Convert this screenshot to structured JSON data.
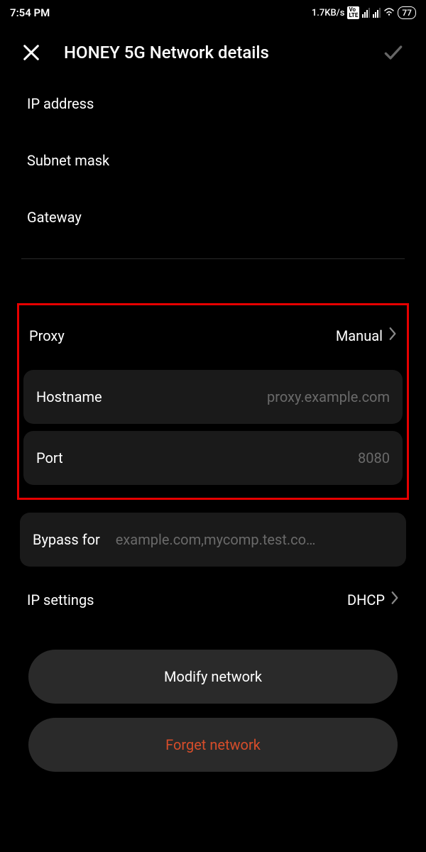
{
  "status_bar": {
    "time": "7:54 PM",
    "speed": "1.7KB/s",
    "volte": "Vo LTE",
    "battery": "77"
  },
  "header": {
    "title": "HONEY 5G Network details"
  },
  "fields": {
    "ip_address_label": "IP address",
    "subnet_mask_label": "Subnet mask",
    "gateway_label": "Gateway"
  },
  "proxy": {
    "label": "Proxy",
    "value": "Manual",
    "hostname_label": "Hostname",
    "hostname_placeholder": "proxy.example.com",
    "port_label": "Port",
    "port_placeholder": "8080"
  },
  "bypass": {
    "label": "Bypass for",
    "placeholder": "example.com,mycomp.test.co…"
  },
  "ip_settings": {
    "label": "IP settings",
    "value": "DHCP"
  },
  "buttons": {
    "modify": "Modify network",
    "forget": "Forget network"
  }
}
